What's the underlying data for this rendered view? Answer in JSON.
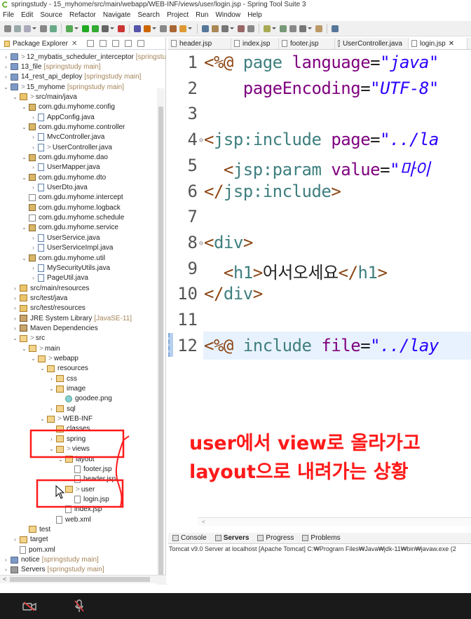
{
  "window": {
    "title": "springstudy - 15_myhome/src/main/webapp/WEB-INF/views/user/login.jsp - Spring Tool Suite 3"
  },
  "menu": [
    "File",
    "Edit",
    "Source",
    "Refactor",
    "Navigate",
    "Search",
    "Project",
    "Run",
    "Window",
    "Help"
  ],
  "explorer": {
    "title": "Package Explorer",
    "items": [
      {
        "indent": 0,
        "twisty": ">",
        "icon": "project",
        "gt": ">",
        "label": "12_mybatis_scheduler_interceptor",
        "deco": "[springstu"
      },
      {
        "indent": 0,
        "twisty": ">",
        "icon": "project",
        "gt": "",
        "label": "13_file",
        "deco": "[springstudy main]"
      },
      {
        "indent": 0,
        "twisty": ">",
        "icon": "project",
        "gt": "",
        "label": "14_rest_api_deploy",
        "deco": "[springstudy main]"
      },
      {
        "indent": 0,
        "twisty": "v",
        "icon": "project",
        "gt": ">",
        "label": "15_myhome",
        "deco": "[springstudy main]"
      },
      {
        "indent": 1,
        "twisty": "v",
        "icon": "srcfolder",
        "gt": ">",
        "label": "src/main/java",
        "deco": ""
      },
      {
        "indent": 2,
        "twisty": "v",
        "icon": "pkg",
        "gt": "",
        "label": "com.gdu.myhome.config",
        "deco": ""
      },
      {
        "indent": 3,
        "twisty": ">",
        "icon": "java",
        "gt": "",
        "label": "AppConfig.java",
        "deco": ""
      },
      {
        "indent": 2,
        "twisty": "v",
        "icon": "pkg",
        "gt": "",
        "label": "com.gdu.myhome.controller",
        "deco": ""
      },
      {
        "indent": 3,
        "twisty": ">",
        "icon": "java",
        "gt": "",
        "label": "MvcController.java",
        "deco": ""
      },
      {
        "indent": 3,
        "twisty": ">",
        "icon": "java",
        "gt": ">",
        "label": "UserController.java",
        "deco": ""
      },
      {
        "indent": 2,
        "twisty": "v",
        "icon": "pkg",
        "gt": "",
        "label": "com.gdu.myhome.dao",
        "deco": ""
      },
      {
        "indent": 3,
        "twisty": ">",
        "icon": "java",
        "gt": "",
        "label": "UserMapper.java",
        "deco": ""
      },
      {
        "indent": 2,
        "twisty": "v",
        "icon": "pkg",
        "gt": "",
        "label": "com.gdu.myhome.dto",
        "deco": ""
      },
      {
        "indent": 3,
        "twisty": ">",
        "icon": "java",
        "gt": "",
        "label": "UserDto.java",
        "deco": ""
      },
      {
        "indent": 2,
        "twisty": "",
        "icon": "pkgempty",
        "gt": "",
        "label": "com.gdu.myhome.intercept",
        "deco": ""
      },
      {
        "indent": 2,
        "twisty": "",
        "icon": "pkg",
        "gt": "",
        "label": "com.gdu.myhome.logback",
        "deco": ""
      },
      {
        "indent": 2,
        "twisty": "",
        "icon": "pkgempty",
        "gt": "",
        "label": "com.gdu.myhome.schedule",
        "deco": ""
      },
      {
        "indent": 2,
        "twisty": "v",
        "icon": "pkg",
        "gt": "",
        "label": "com.gdu.myhome.service",
        "deco": ""
      },
      {
        "indent": 3,
        "twisty": ">",
        "icon": "java",
        "gt": "",
        "label": "UserService.java",
        "deco": ""
      },
      {
        "indent": 3,
        "twisty": ">",
        "icon": "java",
        "gt": "",
        "label": "UserServiceImpl.java",
        "deco": ""
      },
      {
        "indent": 2,
        "twisty": "v",
        "icon": "pkg",
        "gt": "",
        "label": "com.gdu.myhome.util",
        "deco": ""
      },
      {
        "indent": 3,
        "twisty": ">",
        "icon": "java",
        "gt": "",
        "label": "MySecurityUtils.java",
        "deco": ""
      },
      {
        "indent": 3,
        "twisty": ">",
        "icon": "java",
        "gt": "",
        "label": "PageUtil.java",
        "deco": ""
      },
      {
        "indent": 1,
        "twisty": ">",
        "icon": "srcfolder",
        "gt": "",
        "label": "src/main/resources",
        "deco": ""
      },
      {
        "indent": 1,
        "twisty": ">",
        "icon": "srcfolder",
        "gt": "",
        "label": "src/test/java",
        "deco": ""
      },
      {
        "indent": 1,
        "twisty": ">",
        "icon": "srcfolder",
        "gt": "",
        "label": "src/test/resources",
        "deco": ""
      },
      {
        "indent": 1,
        "twisty": ">",
        "icon": "jar",
        "gt": "",
        "label": "JRE System Library",
        "deco": "[JavaSE-11]"
      },
      {
        "indent": 1,
        "twisty": ">",
        "icon": "jar",
        "gt": "",
        "label": "Maven Dependencies",
        "deco": ""
      },
      {
        "indent": 1,
        "twisty": "v",
        "icon": "folder",
        "gt": ">",
        "label": "src",
        "deco": ""
      },
      {
        "indent": 2,
        "twisty": "v",
        "icon": "folder",
        "gt": ">",
        "label": "main",
        "deco": ""
      },
      {
        "indent": 3,
        "twisty": "v",
        "icon": "folder",
        "gt": ">",
        "label": "webapp",
        "deco": ""
      },
      {
        "indent": 4,
        "twisty": "v",
        "icon": "folder",
        "gt": "",
        "label": "resources",
        "deco": ""
      },
      {
        "indent": 5,
        "twisty": ">",
        "icon": "folder",
        "gt": "",
        "label": "css",
        "deco": ""
      },
      {
        "indent": 5,
        "twisty": "v",
        "icon": "folder",
        "gt": "",
        "label": "image",
        "deco": ""
      },
      {
        "indent": 6,
        "twisty": "",
        "icon": "img",
        "gt": "",
        "label": "goodee.png",
        "deco": ""
      },
      {
        "indent": 5,
        "twisty": ">",
        "icon": "folder",
        "gt": "",
        "label": "sql",
        "deco": ""
      },
      {
        "indent": 4,
        "twisty": "v",
        "icon": "folder",
        "gt": ">",
        "label": "WEB-INF",
        "deco": ""
      },
      {
        "indent": 5,
        "twisty": "",
        "icon": "folder",
        "gt": "",
        "label": "classes",
        "deco": ""
      },
      {
        "indent": 5,
        "twisty": ">",
        "icon": "folder",
        "gt": "",
        "label": "spring",
        "deco": ""
      },
      {
        "indent": 5,
        "twisty": "v",
        "icon": "folder",
        "gt": ">",
        "label": "views",
        "deco": ""
      },
      {
        "indent": 6,
        "twisty": "v",
        "icon": "folder",
        "gt": "",
        "label": "layout",
        "deco": ""
      },
      {
        "indent": 7,
        "twisty": "",
        "icon": "file",
        "gt": "",
        "label": "footer.jsp",
        "deco": ""
      },
      {
        "indent": 7,
        "twisty": "",
        "icon": "file",
        "gt": "",
        "label": "header.jsp",
        "deco": ""
      },
      {
        "indent": 6,
        "twisty": "v",
        "icon": "folder",
        "gt": ">",
        "label": "user",
        "deco": ""
      },
      {
        "indent": 7,
        "twisty": "",
        "icon": "file",
        "gt": "",
        "label": "login.jsp",
        "deco": ""
      },
      {
        "indent": 6,
        "twisty": "",
        "icon": "file",
        "gt": "",
        "label": "index.jsp",
        "deco": ""
      },
      {
        "indent": 5,
        "twisty": "",
        "icon": "file",
        "gt": "",
        "label": "web.xml",
        "deco": ""
      },
      {
        "indent": 2,
        "twisty": "",
        "icon": "folder",
        "gt": "",
        "label": "test",
        "deco": ""
      },
      {
        "indent": 1,
        "twisty": ">",
        "icon": "folder",
        "gt": "",
        "label": "target",
        "deco": ""
      },
      {
        "indent": 1,
        "twisty": "",
        "icon": "file",
        "gt": "",
        "label": "pom.xml",
        "deco": ""
      },
      {
        "indent": 0,
        "twisty": ">",
        "icon": "project",
        "gt": "",
        "label": "notice",
        "deco": "[springstudy main]"
      },
      {
        "indent": 0,
        "twisty": ">",
        "icon": "server",
        "gt": "",
        "label": "Servers",
        "deco": "[springstudy main]"
      }
    ]
  },
  "tabs": [
    "header.jsp",
    "index.jsp",
    "footer.jsp",
    "UserController.java",
    "login.jsp"
  ],
  "active_tab": "login.jsp",
  "code_lines": [
    {
      "n": "1",
      "fold": "",
      "parts": [
        [
          "tag",
          "<%@ "
        ],
        [
          "el",
          "page "
        ],
        [
          "attr",
          "language"
        ],
        [
          "txt",
          "="
        ],
        [
          "str",
          "\"java\""
        ]
      ]
    },
    {
      "n": "2",
      "fold": "",
      "parts": [
        [
          "txt",
          "    "
        ],
        [
          "attr",
          "pageEncoding"
        ],
        [
          "txt",
          "="
        ],
        [
          "str",
          "\"UTF-8\""
        ]
      ]
    },
    {
      "n": "3",
      "fold": "",
      "parts": []
    },
    {
      "n": "4",
      "fold": "⊖",
      "parts": [
        [
          "tag",
          "<"
        ],
        [
          "el",
          "jsp:include "
        ],
        [
          "attr",
          "page"
        ],
        [
          "txt",
          "="
        ],
        [
          "str",
          "\"../la"
        ]
      ]
    },
    {
      "n": "5",
      "fold": "",
      "parts": [
        [
          "txt",
          "  "
        ],
        [
          "tag",
          "<"
        ],
        [
          "el",
          "jsp:param "
        ],
        [
          "attr",
          "value"
        ],
        [
          "txt",
          "="
        ],
        [
          "str",
          "\"마이"
        ]
      ]
    },
    {
      "n": "6",
      "fold": "",
      "parts": [
        [
          "tag",
          "</"
        ],
        [
          "el",
          "jsp:include"
        ],
        [
          "tag",
          ">"
        ]
      ]
    },
    {
      "n": "7",
      "fold": "",
      "parts": []
    },
    {
      "n": "8",
      "fold": "⊖",
      "parts": [
        [
          "tag",
          "<"
        ],
        [
          "el",
          "div"
        ],
        [
          "tag",
          ">"
        ]
      ]
    },
    {
      "n": "9",
      "fold": "",
      "parts": [
        [
          "txt",
          "  "
        ],
        [
          "tag",
          "<"
        ],
        [
          "el",
          "h1"
        ],
        [
          "tag",
          ">"
        ],
        [
          "txt",
          "어서오세요"
        ],
        [
          "tag",
          "</"
        ],
        [
          "el",
          "h1"
        ],
        [
          "tag",
          ">"
        ]
      ]
    },
    {
      "n": "10",
      "fold": "",
      "parts": [
        [
          "tag",
          "</"
        ],
        [
          "el",
          "div"
        ],
        [
          "tag",
          ">"
        ]
      ]
    },
    {
      "n": "11",
      "fold": "",
      "parts": []
    },
    {
      "n": "12",
      "fold": "",
      "parts": [
        [
          "tag",
          "<%@ "
        ],
        [
          "el",
          "include "
        ],
        [
          "attr",
          "file"
        ],
        [
          "txt",
          "="
        ],
        [
          "str",
          "\"../lay"
        ]
      ]
    }
  ],
  "annotation": {
    "line1": "user에서 view로 올라가고",
    "line2": "layout으로 내려가는 상황"
  },
  "bottom_tabs": [
    "Console",
    "Servers",
    "Progress",
    "Problems"
  ],
  "console_text": "Tomcat v9.0 Server at localhost [Apache Tomcat] C:₩Program Files₩Java₩jdk-11₩bin₩javaw.exe  (2",
  "colors": {
    "annotation": "#ff1a1a",
    "current_line": "#e8f2fe"
  }
}
